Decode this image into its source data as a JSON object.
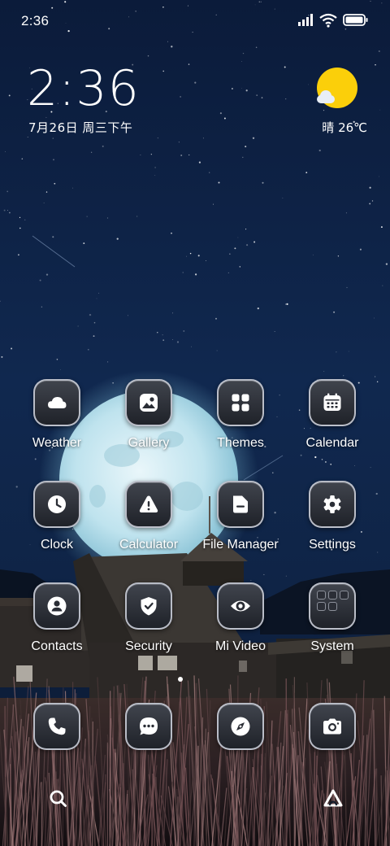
{
  "status_bar": {
    "time": "2:36",
    "icons": [
      "signal-icon",
      "wifi-icon",
      "battery-icon"
    ]
  },
  "clock_widget": {
    "time": "2:36",
    "date": "7月26日 周三下午"
  },
  "weather_widget": {
    "icon": "sunny-cloud-icon",
    "text": "晴 26℃"
  },
  "apps": [
    {
      "label": "Weather",
      "icon": "weather-cloud-icon"
    },
    {
      "label": "Gallery",
      "icon": "gallery-icon"
    },
    {
      "label": "Themes",
      "icon": "themes-icon"
    },
    {
      "label": "Calendar",
      "icon": "calendar-icon"
    },
    {
      "label": "Clock",
      "icon": "clock-icon"
    },
    {
      "label": "Calculator",
      "icon": "warning-icon"
    },
    {
      "label": "File Manager",
      "icon": "folder-icon"
    },
    {
      "label": "Settings",
      "icon": "gear-icon"
    },
    {
      "label": "Contacts",
      "icon": "contacts-icon"
    },
    {
      "label": "Security",
      "icon": "shield-icon"
    },
    {
      "label": "Mi Video",
      "icon": "eye-icon"
    },
    {
      "label": "System",
      "icon": "folder-apps-icon"
    }
  ],
  "dock": [
    {
      "icon": "phone-icon"
    },
    {
      "icon": "messages-icon"
    },
    {
      "icon": "compass-icon"
    },
    {
      "icon": "camera-icon"
    }
  ],
  "bottom_bar": {
    "left_icon": "search-icon",
    "right_icon": "app-drawer-icon"
  },
  "colors": {
    "sky": "#0c1d3c",
    "sun": "#fbcf0a",
    "icon_bg": "#2a2d35",
    "icon_border": "#d2d6e0"
  }
}
